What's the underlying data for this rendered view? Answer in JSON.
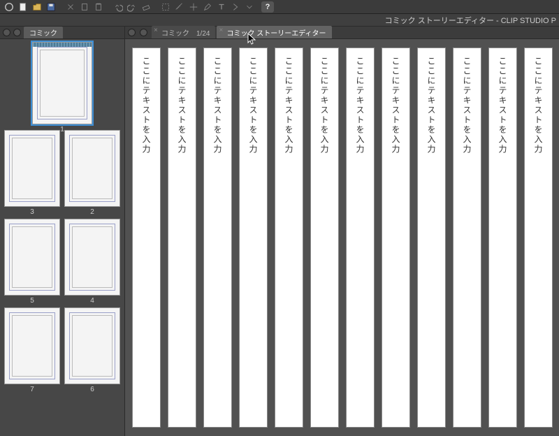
{
  "app_title": "コミック ストーリーエディター - CLIP STUDIO P",
  "sidebar": {
    "tab_label": "コミック",
    "page_rows": [
      {
        "pages": [
          {
            "num": "1",
            "selected": true,
            "topstrip": true
          }
        ]
      },
      {
        "pages": [
          {
            "num": "3"
          },
          {
            "num": "2"
          }
        ]
      },
      {
        "pages": [
          {
            "num": "5"
          },
          {
            "num": "4"
          }
        ]
      },
      {
        "pages": [
          {
            "num": "7"
          },
          {
            "num": "6"
          }
        ]
      }
    ]
  },
  "canvas": {
    "tabs": [
      {
        "label": "コミック　1/24",
        "active": false
      },
      {
        "label": "コミック ストーリーエディター",
        "active": true
      }
    ],
    "story_placeholder": "ここにテキストを入力",
    "story_columns": 12
  },
  "toolbar": {
    "help": "?"
  }
}
